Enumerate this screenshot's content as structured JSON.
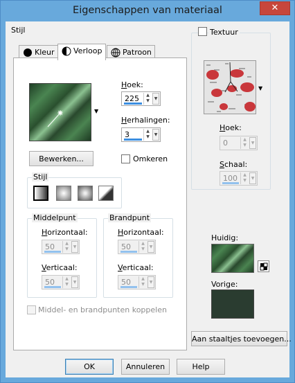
{
  "window": {
    "title": "Eigenschappen van materiaal",
    "close_symbol": "✕"
  },
  "style_section": {
    "label": "Stijl",
    "tabs": [
      {
        "label": "Kleur",
        "icon": "solid-circle-icon"
      },
      {
        "label": "Verloop",
        "icon": "gradient-circle-icon",
        "active": true
      },
      {
        "label": "Patroon",
        "icon": "globe-pattern-icon"
      }
    ]
  },
  "gradient": {
    "angle_label": "Hoek:",
    "angle_value": "225",
    "repeats_label": "Herhalingen:",
    "repeats_value": "3",
    "edit_button": "Bewerken...",
    "invert_label": "Omkeren",
    "invert_checked": false,
    "style_label": "Stijl",
    "style_options": [
      "linear",
      "rectangular",
      "sunburst",
      "radial"
    ],
    "center_point": {
      "label": "Middelpunt",
      "horizontal_label": "Horizontaal:",
      "horizontal_value": "50",
      "vertical_label": "Verticaal:",
      "vertical_value": "50"
    },
    "focal_point": {
      "label": "Brandpunt",
      "horizontal_label": "Horizontaal:",
      "horizontal_value": "50",
      "vertical_label": "Verticaal:",
      "vertical_value": "50"
    },
    "link_points_label": "Middel- en brandpunten koppelen"
  },
  "texture": {
    "label": "Textuur",
    "checked": false,
    "angle_label": "Hoek:",
    "angle_value": "0",
    "scale_label": "Schaal:",
    "scale_value": "100"
  },
  "current": {
    "label": "Huidig:"
  },
  "previous": {
    "label": "Vorige:",
    "color": "#2a3c30"
  },
  "add_swatches_button": "Aan staaltjes toevoegen...",
  "footer": {
    "ok": "OK",
    "cancel": "Annuleren",
    "help": "Help"
  },
  "colors": {
    "titlebar": "#68a9dc",
    "close": "#c7463b",
    "accent_bar": "#3b8ee0"
  }
}
